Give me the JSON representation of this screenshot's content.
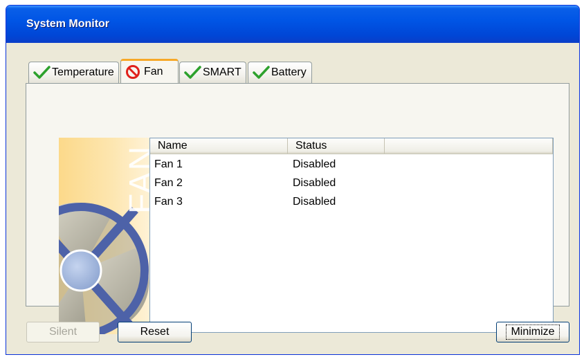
{
  "window": {
    "title": "System Monitor"
  },
  "tabs": [
    {
      "label": "Temperature",
      "icon": "check-icon",
      "active": false
    },
    {
      "label": "Fan",
      "icon": "no-entry-icon",
      "active": true
    },
    {
      "label": "SMART",
      "icon": "check-icon",
      "active": false
    },
    {
      "label": "Battery",
      "icon": "check-icon",
      "active": false
    }
  ],
  "fan_panel": {
    "image_text": "FAN"
  },
  "list": {
    "columns": [
      "Name",
      "Status",
      ""
    ],
    "rows": [
      {
        "name": "Fan 1",
        "status": "Disabled"
      },
      {
        "name": "Fan 2",
        "status": "Disabled"
      },
      {
        "name": "Fan 3",
        "status": "Disabled"
      }
    ]
  },
  "buttons": {
    "silent": "Silent",
    "reset": "Reset",
    "minimize": "Minimize"
  },
  "colors": {
    "titlebar": "#0055e5",
    "active_tab_accent": "#f7a828",
    "check": "#2da12d",
    "no_entry": "#e0201b"
  }
}
